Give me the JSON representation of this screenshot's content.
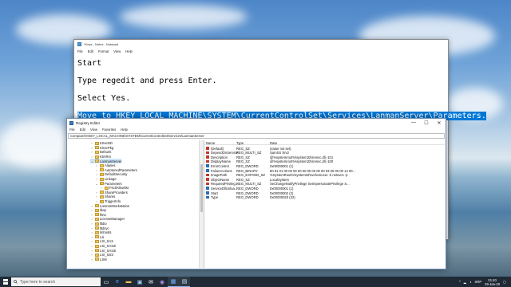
{
  "notepad": {
    "title": "*Keys - Notes - Notepad",
    "menu": [
      "File",
      "Edit",
      "Format",
      "View",
      "Help"
    ],
    "lines": [
      "Start",
      "Type regedit and press Enter.",
      "Select Yes."
    ],
    "highlighted_line": "Move to HKEY_LOCAL_MACHINE\\SYSTEM\\CurrentControlSet\\Services\\LanmanServer\\Parameters."
  },
  "regedit": {
    "title": "Registry Editor",
    "controls": {
      "minimize": "—",
      "maximize": "☐",
      "close": "✕"
    },
    "menu": [
      "File",
      "Edit",
      "View",
      "Favorites",
      "Help"
    ],
    "address": "Computer\\HKEY_LOCAL_MACHINE\\SYSTEM\\CurrentControlSet\\Services\\LanmanServer",
    "tree": [
      {
        "label": "KSecDD",
        "level": 0
      },
      {
        "label": "KSecPkg",
        "level": 0
      },
      {
        "label": "ksthunk",
        "level": 0
      },
      {
        "label": "KtmRm",
        "level": 0
      },
      {
        "label": "LanmanServer",
        "level": 0,
        "expanded": true,
        "selected": true
      },
      {
        "label": "Aliases",
        "level": 1
      },
      {
        "label": "AutotunedParameters",
        "level": 1
      },
      {
        "label": "DefaultSecurity",
        "level": 1
      },
      {
        "label": "Linkage",
        "level": 1
      },
      {
        "label": "Parameters",
        "level": 1,
        "expanded": true
      },
      {
        "label": "FsctlAllowlist",
        "level": 2
      },
      {
        "label": "ShareProviders",
        "level": 1
      },
      {
        "label": "Shares",
        "level": 1
      },
      {
        "label": "TriggerInfo",
        "level": 1
      },
      {
        "label": "LanmanWorkstation",
        "level": 0
      },
      {
        "label": "ldap",
        "level": 0
      },
      {
        "label": "lfsvc",
        "level": 0
      },
      {
        "label": "LicenseManager",
        "level": 0
      },
      {
        "label": "lltdio",
        "level": 0
      },
      {
        "label": "lltdsvc",
        "level": 0
      },
      {
        "label": "lmhosts",
        "level": 0
      },
      {
        "label": "Lsi",
        "level": 0
      },
      {
        "label": "LSI_SAS",
        "level": 0
      },
      {
        "label": "LSI_SAS2i",
        "level": 0
      },
      {
        "label": "LSI_SAS3i",
        "level": 0
      },
      {
        "label": "LSI_SSS",
        "level": 0
      },
      {
        "label": "LSM",
        "level": 0
      }
    ],
    "columns": [
      "Name",
      "Type",
      "Data"
    ],
    "values": [
      {
        "name": "(Default)",
        "type": "REG_SZ",
        "data": "(value not set)",
        "kind": "sz"
      },
      {
        "name": "DependOnService",
        "type": "REG_MULTI_SZ",
        "data": "SamSS Srv2",
        "kind": "sz"
      },
      {
        "name": "Description",
        "type": "REG_SZ",
        "data": "@%systemroot%\\system32\\srvsvc.dll,-101",
        "kind": "sz"
      },
      {
        "name": "DisplayName",
        "type": "REG_SZ",
        "data": "@%systemroot%\\system32\\srvsvc.dll,-100",
        "kind": "sz"
      },
      {
        "name": "ErrorControl",
        "type": "REG_DWORD",
        "data": "0x00000001 (1)",
        "kind": "bin"
      },
      {
        "name": "FailureActions",
        "type": "REG_BINARY",
        "data": "80 51 01 00 00 00 00 00 00 00 00 00 03 00 00 00 14 00...",
        "kind": "bin"
      },
      {
        "name": "ImagePath",
        "type": "REG_EXPAND_SZ",
        "data": "%SystemRoot%\\system32\\svchost.exe -k netsvcs -p",
        "kind": "sz"
      },
      {
        "name": "ObjectName",
        "type": "REG_SZ",
        "data": "LocalSystem",
        "kind": "sz"
      },
      {
        "name": "RequiredPrivileg...",
        "type": "REG_MULTI_SZ",
        "data": "SeChangeNotifyPrivilege SeImpersonatePrivilege S...",
        "kind": "sz"
      },
      {
        "name": "ServiceDllUnloa...",
        "type": "REG_DWORD",
        "data": "0x00000001 (1)",
        "kind": "bin"
      },
      {
        "name": "Start",
        "type": "REG_DWORD",
        "data": "0x00000002 (2)",
        "kind": "bin"
      },
      {
        "name": "Type",
        "type": "REG_DWORD",
        "data": "0x00000020 (32)",
        "kind": "bin"
      }
    ]
  },
  "taskbar": {
    "search_placeholder": "Type here to search",
    "apps": [
      "task-view-icon",
      "edge-icon",
      "explorer-icon",
      "store-icon",
      "mail-icon",
      "media-icon",
      "regedit-icon",
      "notepad-icon"
    ],
    "language": "SRP",
    "time": "01:40",
    "date": "29-Jan-20"
  }
}
